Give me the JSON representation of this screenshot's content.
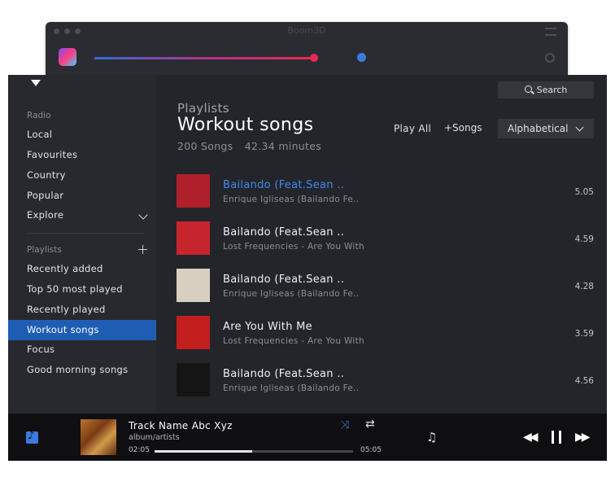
{
  "background_window": {
    "title": "Boom3D"
  },
  "sidebar": {
    "radio_label": "Radio",
    "radio_items": [
      {
        "label": "Local"
      },
      {
        "label": "Favourites"
      },
      {
        "label": "Country"
      },
      {
        "label": "Popular"
      },
      {
        "label": "Explore"
      }
    ],
    "playlists_label": "Playlists",
    "playlist_items": [
      {
        "label": "Recently added"
      },
      {
        "label": "Top 50 most played"
      },
      {
        "label": "Recently played"
      },
      {
        "label": "Workout songs"
      },
      {
        "label": "Focus"
      },
      {
        "label": "Good morning songs"
      }
    ],
    "active_item": "Workout songs"
  },
  "header": {
    "search_label": "Search",
    "section": "Playlists",
    "title": "Workout songs",
    "song_count": "200 Songs",
    "duration": "42.34 minutes",
    "play_all": "Play  All",
    "add_songs": "+Songs",
    "sort": "Alphabetical"
  },
  "songs": [
    {
      "title": "Bailando (Feat.Sean ..",
      "subtitle": "Enrique Igliseas (Bailando Fe..",
      "duration": "5.05",
      "highlight": true,
      "art_color": "#b0202a"
    },
    {
      "title": "Bailando (Feat.Sean ..",
      "subtitle": "Lost Frequencies - Are You With",
      "duration": "4.59",
      "highlight": false,
      "art_color": "#c7252d"
    },
    {
      "title": "Bailando (Feat.Sean ..",
      "subtitle": "Enrique Igliseas (Bailando Fe..",
      "duration": "4.28",
      "highlight": false,
      "art_color": "#d9cfc0"
    },
    {
      "title": "Are You With Me",
      "subtitle": "Lost Frequencies - Are You With",
      "duration": "3.59",
      "highlight": false,
      "art_color": "#c41f1f"
    },
    {
      "title": "Bailando (Feat.Sean ..",
      "subtitle": "Enrique Igliseas (Bailando Fe..",
      "duration": "4.56",
      "highlight": false,
      "art_color": "#151515"
    }
  ],
  "player": {
    "track_name": "Track Name Abc Xyz",
    "subtitle": "album/artists",
    "elapsed": "02:05",
    "total": "05:05",
    "progress": 0.49
  },
  "colors": {
    "accent": "#1f5db5",
    "highlight_text": "#3d8bf0"
  }
}
